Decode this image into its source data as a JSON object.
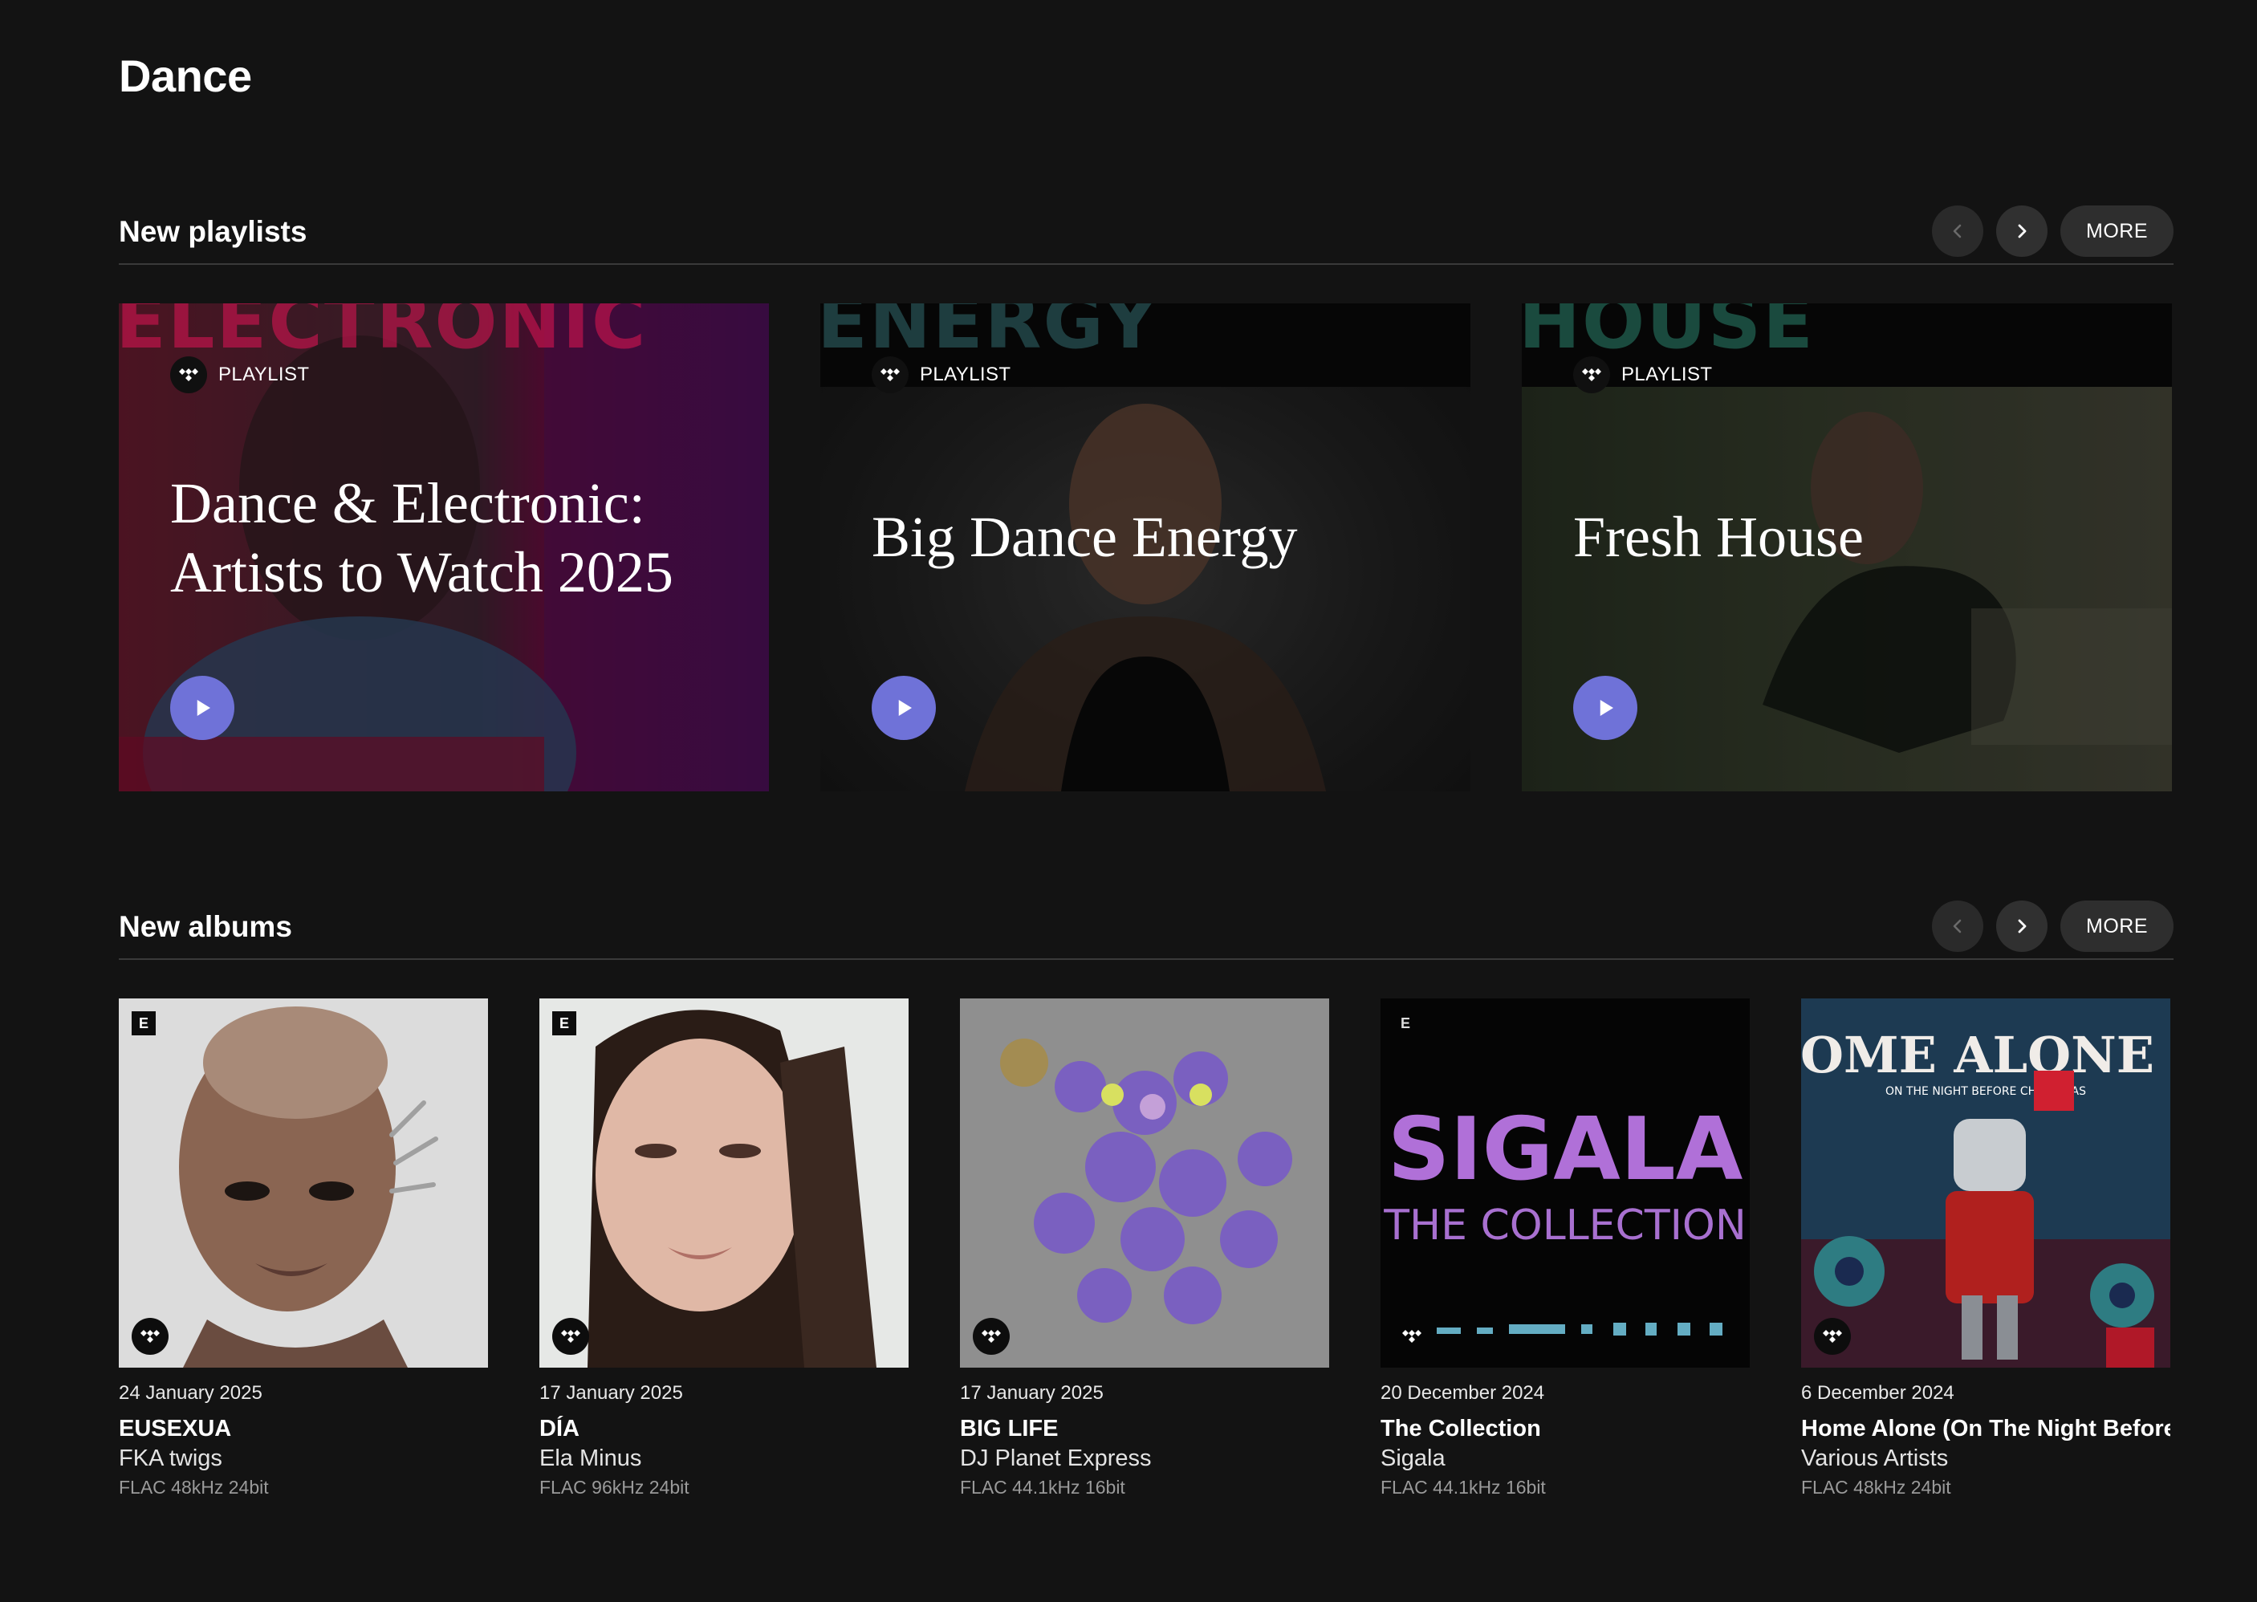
{
  "page": {
    "title": "Dance"
  },
  "sections": {
    "playlists": {
      "title": "New playlists",
      "more_label": "MORE",
      "items": [
        {
          "badge": "PLAYLIST",
          "title": "Dance & Electronic: Artists to Watch 2025",
          "cover_word": "ELECTRONIC",
          "colors": {
            "accent": "#c8144e",
            "bg": "#8a1239",
            "side": "#6a0f5c"
          }
        },
        {
          "badge": "PLAYLIST",
          "title": "Big Dance Energy",
          "cover_word": "ENERGY",
          "colors": {
            "accent": "#1e3d3f",
            "bg": "#2b2b2b"
          }
        },
        {
          "badge": "PLAYLIST",
          "title": "Fresh House",
          "cover_word": "HOUSE",
          "colors": {
            "accent": "#1a4a3e",
            "bg": "#2e3a2a"
          }
        }
      ]
    },
    "albums": {
      "title": "New albums",
      "more_label": "MORE",
      "items": [
        {
          "date": "24 January 2025",
          "title": "EUSEXUA",
          "artist": "FKA twigs",
          "quality": "FLAC 48kHz 24bit",
          "explicit": "E"
        },
        {
          "date": "17 January 2025",
          "title": "DÍA",
          "artist": "Ela Minus",
          "quality": "FLAC 96kHz 24bit",
          "explicit": "E"
        },
        {
          "date": "17 January 2025",
          "title": "BIG LIFE",
          "artist": "DJ Planet Express",
          "quality": "FLAC 44.1kHz 16bit",
          "explicit": ""
        },
        {
          "date": "20 December 2024",
          "title": "The Collection",
          "artist": "Sigala",
          "quality": "FLAC 44.1kHz 16bit",
          "explicit": "E",
          "cover_text": "SIGALA",
          "cover_subtext": "THE COLLECTION"
        },
        {
          "date": "6 December 2024",
          "title": "Home Alone (On The Night Before",
          "artist": "Various Artists",
          "quality": "FLAC 48kHz 24bit",
          "explicit": "",
          "cover_text": "HOME ALONE II",
          "cover_subtext": "ON THE NIGHT BEFORE CHRISTMAS"
        }
      ]
    }
  },
  "icons": {
    "prev": "chevron-left-icon",
    "next": "chevron-right-icon",
    "play": "play-icon",
    "tidal": "tidal-logo-icon"
  }
}
